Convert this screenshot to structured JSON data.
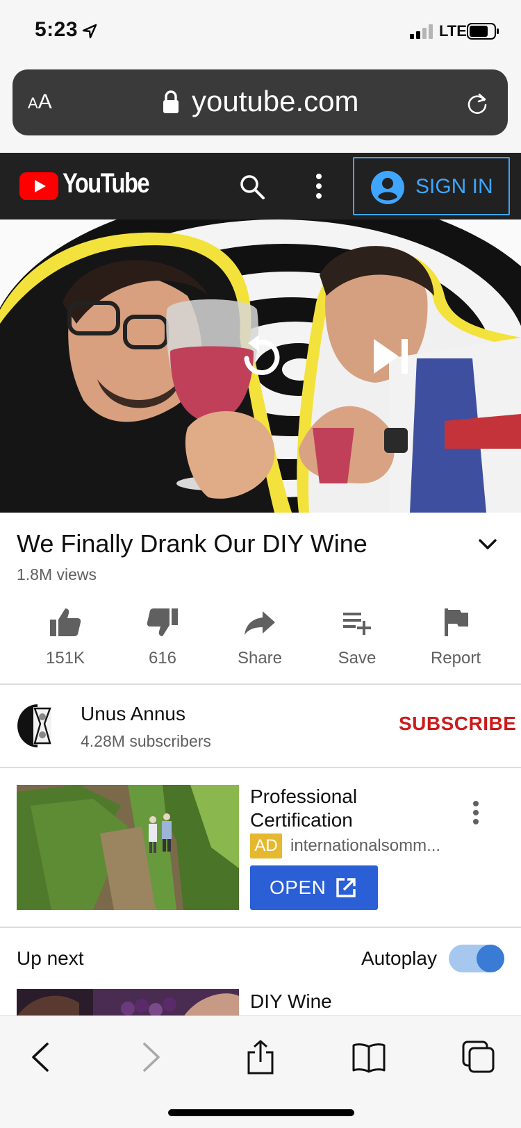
{
  "status_bar": {
    "time": "5:23",
    "network": "LTE"
  },
  "browser": {
    "text_size_label": "A",
    "text_size_label_large": "A",
    "url": "youtube.com"
  },
  "youtube_header": {
    "wordmark": "YouTube",
    "sign_in_label": "SIGN IN"
  },
  "video": {
    "title": "We Finally Drank Our DIY Wine",
    "views": "1.8M views",
    "actions": [
      {
        "label": "151K",
        "icon": "thumbs-up-icon"
      },
      {
        "label": "616",
        "icon": "thumbs-down-icon"
      },
      {
        "label": "Share",
        "icon": "share-icon"
      },
      {
        "label": "Save",
        "icon": "playlist-add-icon"
      },
      {
        "label": "Report",
        "icon": "flag-icon"
      }
    ]
  },
  "channel": {
    "name": "Unus Annus",
    "subscribers": "4.28M subscribers",
    "subscribe_label": "SUBSCRIBE"
  },
  "ad": {
    "title": "Professional Certification",
    "badge": "AD",
    "domain": "internationalsomm...",
    "cta_label": "OPEN"
  },
  "up_next": {
    "heading": "Up next",
    "autoplay_label": "Autoplay",
    "autoplay_on": true,
    "next_title": "DIY Wine"
  },
  "colors": {
    "youtube_red": "#ff0000",
    "subscribe_red": "#cc1a1a",
    "sign_in_blue": "#3ea6ff",
    "ad_badge": "#e6b82f",
    "open_button": "#2a5fd6"
  }
}
